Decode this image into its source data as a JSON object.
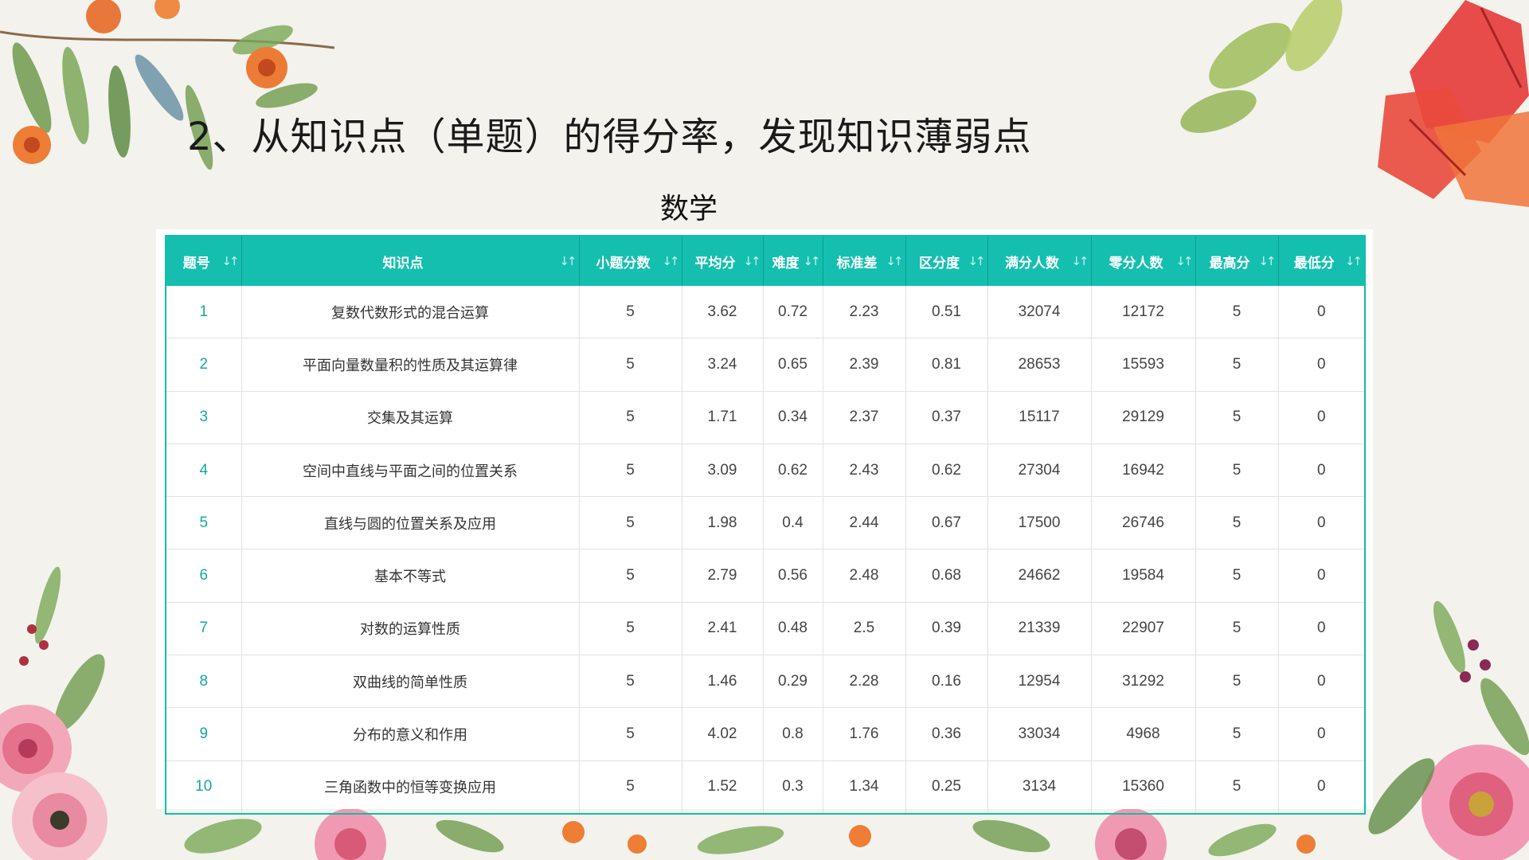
{
  "slide": {
    "title": "2、从知识点（单题）的得分率，发现知识薄弱点",
    "subject": "数学"
  },
  "table": {
    "sort_icon": "sort-arrows-icon",
    "columns": [
      "题号",
      "知识点",
      "小题分数",
      "平均分",
      "难度",
      "标准差",
      "区分度",
      "满分人数",
      "零分人数",
      "最高分",
      "最低分"
    ],
    "rows": [
      [
        "1",
        "复数代数形式的混合运算",
        "5",
        "3.62",
        "0.72",
        "2.23",
        "0.51",
        "32074",
        "12172",
        "5",
        "0"
      ],
      [
        "2",
        "平面向量数量积的性质及其运算律",
        "5",
        "3.24",
        "0.65",
        "2.39",
        "0.81",
        "28653",
        "15593",
        "5",
        "0"
      ],
      [
        "3",
        "交集及其运算",
        "5",
        "1.71",
        "0.34",
        "2.37",
        "0.37",
        "15117",
        "29129",
        "5",
        "0"
      ],
      [
        "4",
        "空间中直线与平面之间的位置关系",
        "5",
        "3.09",
        "0.62",
        "2.43",
        "0.62",
        "27304",
        "16942",
        "5",
        "0"
      ],
      [
        "5",
        "直线与圆的位置关系及应用",
        "5",
        "1.98",
        "0.4",
        "2.44",
        "0.67",
        "17500",
        "26746",
        "5",
        "0"
      ],
      [
        "6",
        "基本不等式",
        "5",
        "2.79",
        "0.56",
        "2.48",
        "0.68",
        "24662",
        "19584",
        "5",
        "0"
      ],
      [
        "7",
        "对数的运算性质",
        "5",
        "2.41",
        "0.48",
        "2.5",
        "0.39",
        "21339",
        "22907",
        "5",
        "0"
      ],
      [
        "8",
        "双曲线的简单性质",
        "5",
        "1.46",
        "0.29",
        "2.28",
        "0.16",
        "12954",
        "31292",
        "5",
        "0"
      ],
      [
        "9",
        "分布的意义和作用",
        "5",
        "4.02",
        "0.8",
        "1.76",
        "0.36",
        "33034",
        "4968",
        "5",
        "0"
      ],
      [
        "10",
        "三角函数中的恒等变换应用",
        "5",
        "1.52",
        "0.3",
        "1.34",
        "0.25",
        "3134",
        "15360",
        "5",
        "0"
      ]
    ]
  },
  "colors": {
    "header_bg": "#14bfb0",
    "index_text": "#14a99c",
    "background": "#f3f2ec"
  }
}
